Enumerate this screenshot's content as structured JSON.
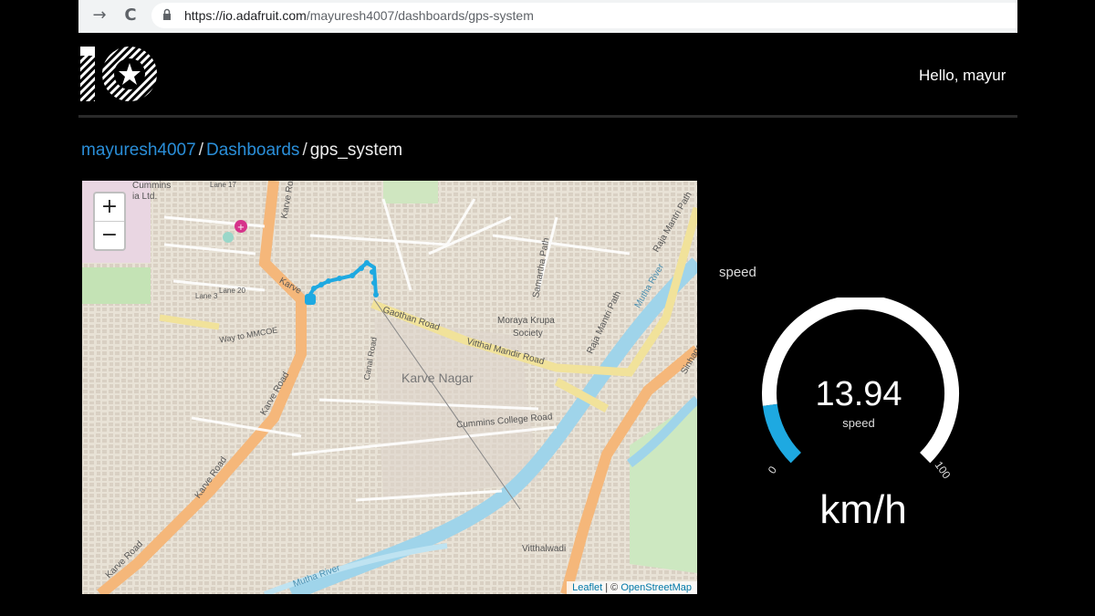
{
  "browser": {
    "back_glyph": "→",
    "reload_glyph": "C",
    "url_host": "https://io.adafruit.com",
    "url_path": "/mayuresh4007/dashboards/gps-system"
  },
  "header": {
    "greeting": "Hello, mayur"
  },
  "breadcrumb": {
    "user": "mayuresh4007",
    "sep": "/",
    "dashboards": "Dashboards",
    "current": "gps_system"
  },
  "map": {
    "zoom_in": "+",
    "zoom_out": "−",
    "attribution": {
      "leaflet": "Leaflet",
      "divider": " | © ",
      "osm": "OpenStreetMap"
    },
    "labels": {
      "karve_road_1": "Karve Road",
      "karve_road_2": "Karve Road",
      "karve_road_3": "Karve Road",
      "gaothan_road": "Gaothan Road",
      "vithal_mandir_road": "Vitthal Mandir Road",
      "karve_nagar": "Karve Nagar",
      "cummins_college_road": "Cummins College Road",
      "morya_krupa": "Moraya Krupa",
      "society": "Society",
      "samartha_path": "Samartha Path",
      "raja_mantri_path": "Raja Mantri Path",
      "mutha_river_1": "Mutha River",
      "mutha_river_2": "Mutha River",
      "sinhagad": "Sinhaga",
      "way_to_mmcoe": "Way to MMCOE",
      "canal_road": "Canal Road",
      "vitthalwadi": "Vitthalwadi",
      "cummins": "Cummins",
      "cummins_ltd": "ia Ltd.",
      "lane_17": "Lane 17",
      "lane_3": "Lane 3",
      "lane_20": "Lane 20",
      "karve_1": "Karve",
      "karve_road_vert": "Karve Road"
    },
    "colors": {
      "route": "#1ea9e1",
      "major_road": "#f5b77a",
      "secondary_road": "#f1e29a",
      "river": "#9fd4ea"
    }
  },
  "gauge": {
    "title": "speed",
    "value": "13.94",
    "value_numeric": 13.94,
    "min": "0",
    "max": "100",
    "label": "speed",
    "unit": "km/h",
    "fill_color": "#1ea9e1",
    "track_color": "#ffffff"
  }
}
